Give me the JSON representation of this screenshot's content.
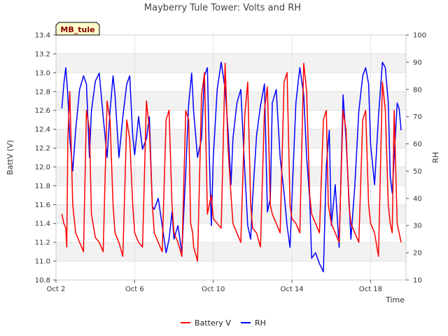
{
  "chart_data": {
    "type": "line",
    "title": "Mayberry Tule Tower: Volts and RH",
    "site_badge": "MB_tule",
    "xlabel": "Time",
    "ylabel_left": "BattV (V)",
    "ylabel_right": "RH",
    "x_ticks": [
      "Oct 2",
      "Oct 6",
      "Oct 10",
      "Oct 14",
      "Oct 18"
    ],
    "x_tick_days": [
      2,
      6,
      10,
      14,
      18
    ],
    "xlim_days": [
      2,
      19.8
    ],
    "y_left_ticks": [
      10.8,
      11.0,
      11.2,
      11.4,
      11.6,
      11.8,
      12.0,
      12.2,
      12.4,
      12.6,
      12.8,
      13.0,
      13.2,
      13.4
    ],
    "y_left_tick_labels": [
      "10.8",
      "11.0",
      "11.2",
      "11.4",
      "11.6",
      "11.8",
      "12.0",
      "12.2",
      "12.4",
      "12.6",
      "12.8",
      "13.0",
      "13.2",
      "13.4"
    ],
    "ylim_left": [
      10.8,
      13.4
    ],
    "y_right_ticks": [
      10,
      20,
      30,
      40,
      50,
      60,
      70,
      80,
      90,
      100
    ],
    "y_right_tick_labels": [
      "10",
      "20",
      "30",
      "40",
      "50",
      "60",
      "70",
      "80",
      "90",
      "100"
    ],
    "ylim_right": [
      10,
      100
    ],
    "grid": true,
    "legend_position": "bottom-center",
    "series": [
      {
        "name": "Battery V",
        "axis": "left",
        "color": "#ff0000",
        "x": [
          2.3,
          2.4,
          2.5,
          2.55,
          2.6,
          2.7,
          2.85,
          3.0,
          3.2,
          3.4,
          3.55,
          3.7,
          3.8,
          4.0,
          4.2,
          4.4,
          4.6,
          4.75,
          4.9,
          5.0,
          5.2,
          5.4,
          5.6,
          5.75,
          5.9,
          6.0,
          6.2,
          6.4,
          6.6,
          6.75,
          6.9,
          7.0,
          7.2,
          7.4,
          7.6,
          7.75,
          7.9,
          8.0,
          8.2,
          8.4,
          8.6,
          8.75,
          8.85,
          8.95,
          9.0,
          9.2,
          9.4,
          9.55,
          9.7,
          9.8,
          9.9,
          10.0,
          10.2,
          10.4,
          10.6,
          10.75,
          10.9,
          11.0,
          11.2,
          11.4,
          11.6,
          11.75,
          11.9,
          12.0,
          12.2,
          12.4,
          12.6,
          12.75,
          12.9,
          13.0,
          13.2,
          13.4,
          13.6,
          13.75,
          13.9,
          14.0,
          14.2,
          14.4,
          14.6,
          14.75,
          14.9,
          15.0,
          15.2,
          15.4,
          15.6,
          15.75,
          15.85,
          16.0,
          16.2,
          16.4,
          16.6,
          16.75,
          16.9,
          17.0,
          17.2,
          17.4,
          17.6,
          17.75,
          17.9,
          18.0,
          18.2,
          18.4,
          18.6,
          18.75,
          18.9,
          19.0,
          19.1,
          19.2,
          19.35,
          19.45,
          19.55
        ],
        "y": [
          11.5,
          11.4,
          11.35,
          11.15,
          12.3,
          12.8,
          11.6,
          11.3,
          11.2,
          11.1,
          12.6,
          12.4,
          11.5,
          11.25,
          11.2,
          11.1,
          12.7,
          12.5,
          11.6,
          11.3,
          11.2,
          11.05,
          12.5,
          12.3,
          11.6,
          11.3,
          11.2,
          11.15,
          12.7,
          12.4,
          11.6,
          11.3,
          11.2,
          11.1,
          12.5,
          12.6,
          11.6,
          11.3,
          11.2,
          11.05,
          12.6,
          12.5,
          11.4,
          11.3,
          11.15,
          11.0,
          12.75,
          13.0,
          11.5,
          11.6,
          11.7,
          11.45,
          11.4,
          11.35,
          13.1,
          12.2,
          11.7,
          11.4,
          11.3,
          11.2,
          12.55,
          12.9,
          11.6,
          11.35,
          11.3,
          11.15,
          12.6,
          12.85,
          11.6,
          11.5,
          11.4,
          11.3,
          12.9,
          13.0,
          11.6,
          11.45,
          11.4,
          11.3,
          13.1,
          12.8,
          11.7,
          11.5,
          11.4,
          11.3,
          12.5,
          12.6,
          11.6,
          11.4,
          11.3,
          11.2,
          12.6,
          12.4,
          11.6,
          11.4,
          11.3,
          11.2,
          12.5,
          12.6,
          11.6,
          11.4,
          11.3,
          11.05,
          12.9,
          12.6,
          11.6,
          11.4,
          11.3,
          12.6,
          11.4,
          11.3,
          11.2
        ]
      },
      {
        "name": "RH",
        "axis": "right",
        "color": "#0000ff",
        "x": [
          2.3,
          2.4,
          2.5,
          2.6,
          2.7,
          2.85,
          3.0,
          3.2,
          3.4,
          3.55,
          3.7,
          3.8,
          4.0,
          4.2,
          4.4,
          4.6,
          4.75,
          4.9,
          5.0,
          5.2,
          5.4,
          5.6,
          5.75,
          5.9,
          6.0,
          6.2,
          6.4,
          6.6,
          6.75,
          6.9,
          7.0,
          7.2,
          7.4,
          7.6,
          7.75,
          7.9,
          8.0,
          8.2,
          8.4,
          8.6,
          8.75,
          8.9,
          9.0,
          9.2,
          9.4,
          9.55,
          9.7,
          9.8,
          9.9,
          10.0,
          10.2,
          10.4,
          10.6,
          10.75,
          10.9,
          11.0,
          11.2,
          11.4,
          11.6,
          11.75,
          11.9,
          12.0,
          12.2,
          12.4,
          12.6,
          12.75,
          12.9,
          13.0,
          13.2,
          13.4,
          13.6,
          13.75,
          13.9,
          14.0,
          14.2,
          14.4,
          14.6,
          14.75,
          14.9,
          15.0,
          15.2,
          15.4,
          15.6,
          15.75,
          15.9,
          16.0,
          16.2,
          16.4,
          16.6,
          16.75,
          16.9,
          17.0,
          17.2,
          17.4,
          17.6,
          17.75,
          17.9,
          18.0,
          18.2,
          18.4,
          18.6,
          18.75,
          18.9,
          19.0,
          19.1,
          19.2,
          19.35,
          19.45,
          19.55
        ],
        "y": [
          73,
          82,
          88,
          78,
          62,
          50,
          65,
          80,
          85,
          82,
          55,
          72,
          83,
          86,
          70,
          55,
          72,
          85,
          78,
          55,
          70,
          82,
          85,
          63,
          56,
          70,
          58,
          62,
          70,
          37,
          36,
          40,
          30,
          20,
          25,
          35,
          25,
          30,
          20,
          50,
          75,
          86,
          72,
          55,
          62,
          85,
          88,
          55,
          30,
          55,
          80,
          90,
          80,
          65,
          45,
          62,
          75,
          80,
          50,
          30,
          25,
          40,
          63,
          74,
          82,
          35,
          40,
          75,
          80,
          55,
          42,
          30,
          22,
          40,
          75,
          88,
          78,
          55,
          40,
          18,
          20,
          16,
          13,
          52,
          65,
          30,
          45,
          22,
          78,
          62,
          40,
          25,
          45,
          72,
          85,
          88,
          82,
          60,
          45,
          70,
          90,
          88,
          75,
          48,
          42,
          55,
          75,
          73,
          65
        ]
      }
    ]
  }
}
